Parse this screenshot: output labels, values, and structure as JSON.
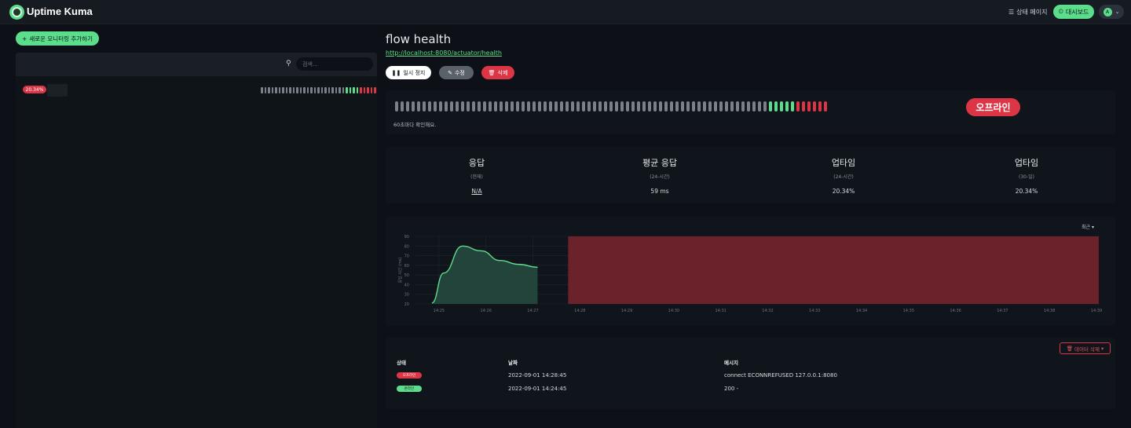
{
  "header": {
    "brand": "Uptime Kuma",
    "status_page_label": "상태 페이지",
    "dashboard_label": "대시보드",
    "avatar_letter": "A"
  },
  "sidebar": {
    "add_button_label": "새로운 모니터링 추가하기",
    "search_placeholder": "검색...",
    "monitors": [
      {
        "uptime": "20.34%",
        "beats": [
          "none",
          "none",
          "none",
          "none",
          "none",
          "none",
          "none",
          "none",
          "none",
          "none",
          "none",
          "none",
          "none",
          "none",
          "none",
          "none",
          "none",
          "none",
          "none",
          "none",
          "none",
          "none",
          "none",
          "none",
          "up",
          "up",
          "up",
          "up",
          "down",
          "down",
          "down",
          "down",
          "down"
        ]
      }
    ]
  },
  "monitor": {
    "name": "flow health",
    "url": "http://localhost:8080/actuator/health",
    "pause_label": "일시 정지",
    "edit_label": "수정",
    "delete_label": "삭제",
    "status": "오프라인",
    "interval_text": "60초마다 확인해요.",
    "beats": [
      "none",
      "none",
      "none",
      "none",
      "none",
      "none",
      "none",
      "none",
      "none",
      "none",
      "none",
      "none",
      "none",
      "none",
      "none",
      "none",
      "none",
      "none",
      "none",
      "none",
      "none",
      "none",
      "none",
      "none",
      "none",
      "none",
      "none",
      "none",
      "none",
      "none",
      "none",
      "none",
      "none",
      "none",
      "none",
      "none",
      "none",
      "none",
      "none",
      "none",
      "none",
      "none",
      "none",
      "none",
      "none",
      "none",
      "none",
      "none",
      "none",
      "none",
      "none",
      "none",
      "none",
      "none",
      "none",
      "none",
      "none",
      "none",
      "none",
      "none",
      "none",
      "none",
      "none",
      "none",
      "none",
      "none",
      "none",
      "none",
      "up",
      "up",
      "up",
      "up",
      "up",
      "down",
      "down",
      "down",
      "down",
      "down",
      "down"
    ]
  },
  "stats": [
    {
      "label": "응답",
      "sub": "(현재)",
      "value": "N/A",
      "underline": true
    },
    {
      "label": "평균 응답",
      "sub": "(24-시간)",
      "value": "59 ms",
      "underline": false
    },
    {
      "label": "업타임",
      "sub": "(24-시간)",
      "value": "20.34%",
      "underline": false
    },
    {
      "label": "업타임",
      "sub": "(30-일)",
      "value": "20.34%",
      "underline": false
    }
  ],
  "chart_period_label": "최근",
  "chart_data": {
    "type": "area",
    "ylabel": "응답 시간 (ms)",
    "ylim": [
      20,
      90
    ],
    "yticks": [
      20,
      30,
      40,
      50,
      60,
      70,
      80,
      90
    ],
    "xticks": [
      "14:25",
      "14:26",
      "14:27",
      "14:28",
      "14:29",
      "14:30",
      "14:31",
      "14:32",
      "14:33",
      "14:34",
      "14:35",
      "14:36",
      "14:37",
      "14:38",
      "14:39"
    ],
    "series": [
      {
        "x": [
          0.35,
          0.6,
          1.0,
          1.4,
          1.8,
          2.2,
          2.6
        ],
        "values": [
          21,
          52,
          80,
          75,
          65,
          61,
          58
        ]
      }
    ],
    "down_range": [
      3.25,
      14.55
    ],
    "colors": {
      "up_line": "#5cdd8b",
      "up_fill": "#23443a",
      "down_fill": "#6b222a"
    }
  },
  "events": {
    "clear_label": "데이터 삭제",
    "columns": [
      "상태",
      "날짜",
      "메시지"
    ],
    "rows": [
      {
        "status": "오프라인",
        "kind": "down",
        "date": "2022-09-01 14:28:45",
        "message": "connect ECONNREFUSED 127.0.0.1:8080"
      },
      {
        "status": "온라인",
        "kind": "up",
        "date": "2022-09-01 14:24:45",
        "message": "200 -"
      }
    ]
  },
  "colors": {
    "accent": "#5cdd8b",
    "danger": "#dc3545",
    "beat_empty": "#7a818a",
    "background": "#0d1117"
  }
}
